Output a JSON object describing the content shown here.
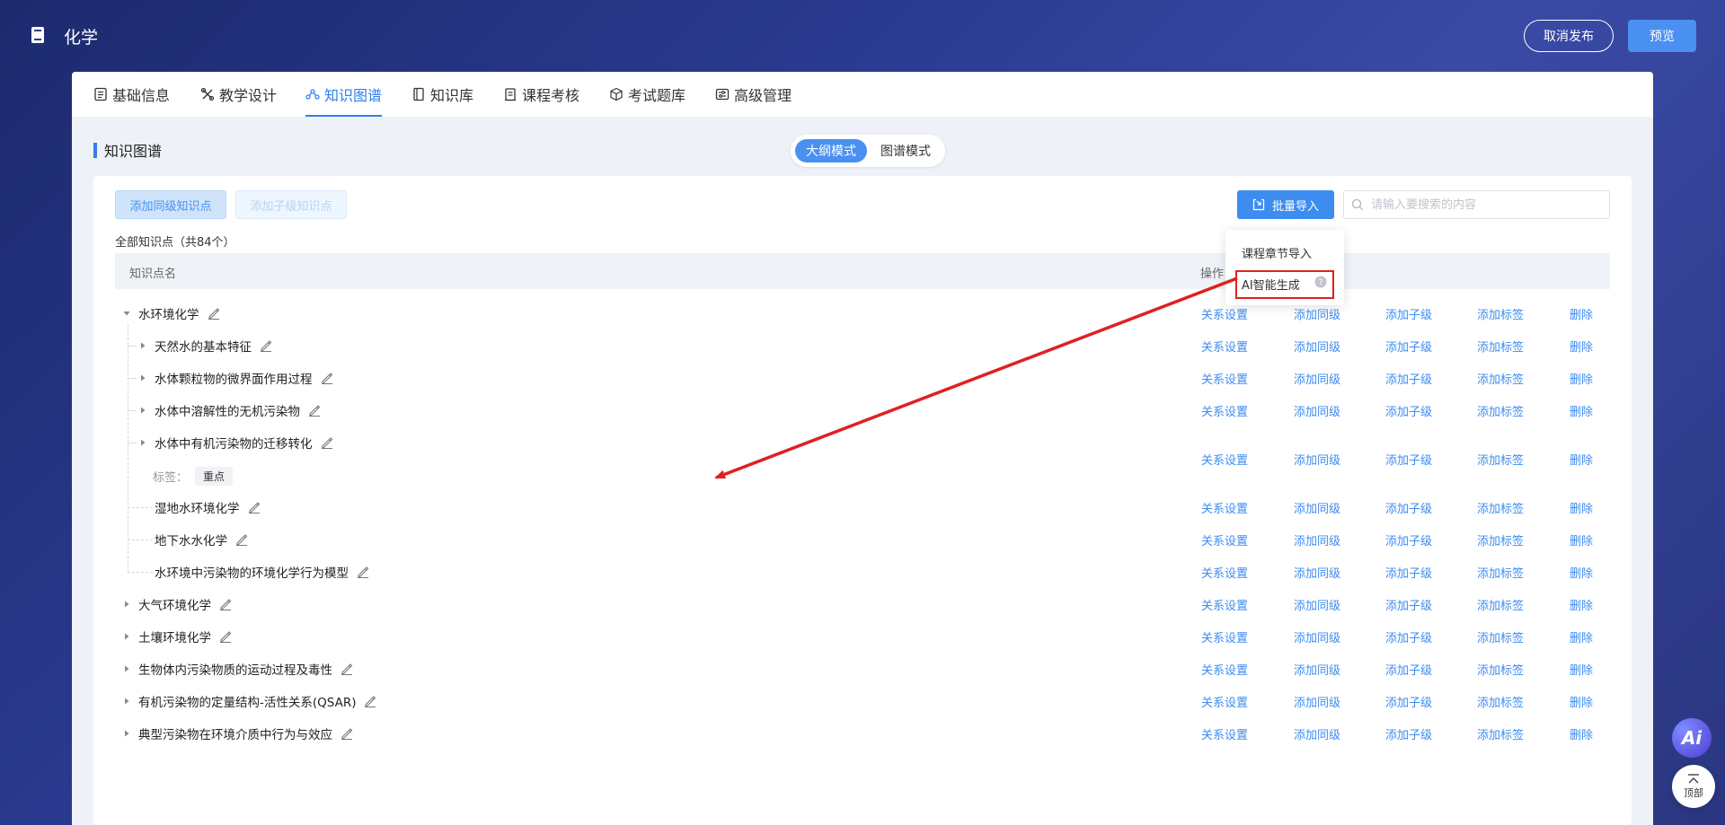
{
  "header": {
    "course_title": "化学",
    "unpublish_label": "取消发布",
    "preview_label": "预览"
  },
  "tabs": [
    {
      "label": "基础信息",
      "icon": "document-list-icon"
    },
    {
      "label": "教学设计",
      "icon": "tools-icon"
    },
    {
      "label": "知识图谱",
      "icon": "graph-nodes-icon",
      "active": true
    },
    {
      "label": "知识库",
      "icon": "book-icon"
    },
    {
      "label": "课程考核",
      "icon": "clipboard-icon"
    },
    {
      "label": "考试题库",
      "icon": "cube-icon"
    },
    {
      "label": "高级管理",
      "icon": "settings-panel-icon"
    }
  ],
  "section": {
    "title": "知识图谱",
    "modes": [
      "大纲模式",
      "图谱模式"
    ],
    "active_mode": "大纲模式"
  },
  "toolbar": {
    "add_sibling_label": "添加同级知识点",
    "add_child_label": "添加子级知识点",
    "batch_import_label": "批量导入",
    "search_placeholder": "请输入要搜索的内容"
  },
  "summary": "全部知识点（共84个）",
  "table": {
    "col_name": "知识点名",
    "col_ops": "操作"
  },
  "row_ops": [
    "关系设置",
    "添加同级",
    "添加子级",
    "添加标签",
    "删除"
  ],
  "nodes": [
    {
      "label": "水环境化学",
      "level": 0,
      "state": "expanded"
    },
    {
      "label": "天然水的基本特征",
      "level": 1,
      "state": "collapsed"
    },
    {
      "label": "水体颗粒物的微界面作用过程",
      "level": 1,
      "state": "collapsed"
    },
    {
      "label": "水体中溶解性的无机污染物",
      "level": 1,
      "state": "collapsed"
    },
    {
      "label": "水体中有机污染物的迁移转化",
      "level": 1,
      "state": "collapsed",
      "tag_label": "标签：",
      "tag": "重点"
    },
    {
      "label": "湿地水环境化学",
      "level": 1,
      "state": "leaf"
    },
    {
      "label": "地下水水化学",
      "level": 1,
      "state": "leaf"
    },
    {
      "label": "水环境中污染物的环境化学行为模型",
      "level": 1,
      "state": "leaf"
    },
    {
      "label": "大气环境化学",
      "level": 0,
      "state": "collapsed"
    },
    {
      "label": "土壤环境化学",
      "level": 0,
      "state": "collapsed"
    },
    {
      "label": "生物体内污染物质的运动过程及毒性",
      "level": 0,
      "state": "collapsed"
    },
    {
      "label": "有机污染物的定量结构-活性关系(QSAR)",
      "level": 0,
      "state": "collapsed"
    },
    {
      "label": "典型污染物在环境介质中行为与效应",
      "level": 0,
      "state": "collapsed"
    }
  ],
  "dropdown": {
    "items": [
      "课程章节导入",
      "AI智能生成"
    ],
    "highlighted": "AI智能生成"
  },
  "floating": {
    "ai_label": "Ai",
    "top_label": "顶部"
  },
  "colors": {
    "accent": "#2f80ed",
    "link": "#3d8cf0",
    "annotation": "#e02020"
  }
}
